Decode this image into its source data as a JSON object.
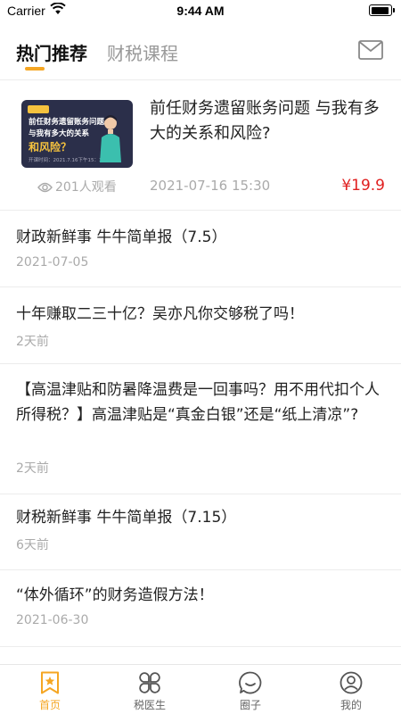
{
  "status_bar": {
    "carrier": "Carrier",
    "time": "9:44 AM"
  },
  "top_tabs": {
    "active": "热门推荐",
    "inactive": "财税课程"
  },
  "featured": {
    "thumb_line1": "前任财务遗留账务问题",
    "thumb_line2": "与我有多大的关系",
    "thumb_line3": "和风险？",
    "thumb_line4": "开课时间：2021.7.16下午15：30",
    "title": "前任财务遗留账务问题 与我有多大的关系和风险?",
    "views": "201人观看",
    "date": "2021-07-16 15:30",
    "price": "¥19.9"
  },
  "articles": [
    {
      "title": "财政新鲜事 牛牛简单报（7.5）",
      "meta": "2021-07-05"
    },
    {
      "title": "十年赚取二三十亿？吴亦凡你交够税了吗！",
      "meta": "2天前"
    },
    {
      "title": "【高温津贴和防暑降温费是一回事吗？用不用代扣个人所得税？】高温津贴是“真金白银”还是“纸上清凉”?",
      "meta": "2天前"
    },
    {
      "title": "财税新鲜事 牛牛简单报（7.15）",
      "meta": "6天前"
    },
    {
      "title": "“体外循环”的财务造假方法！",
      "meta": "2021-06-30"
    }
  ],
  "bottom_nav": [
    {
      "label": "首页",
      "icon": "bookmark-star-icon",
      "active": true
    },
    {
      "label": "税医生",
      "icon": "four-petal-icon",
      "active": false
    },
    {
      "label": "圈子",
      "icon": "chat-bubble-icon",
      "active": false
    },
    {
      "label": "我的",
      "icon": "user-profile-icon",
      "active": false
    }
  ],
  "colors": {
    "accent": "#f5a623",
    "price": "#e02020",
    "muted": "#aaaaaa"
  }
}
